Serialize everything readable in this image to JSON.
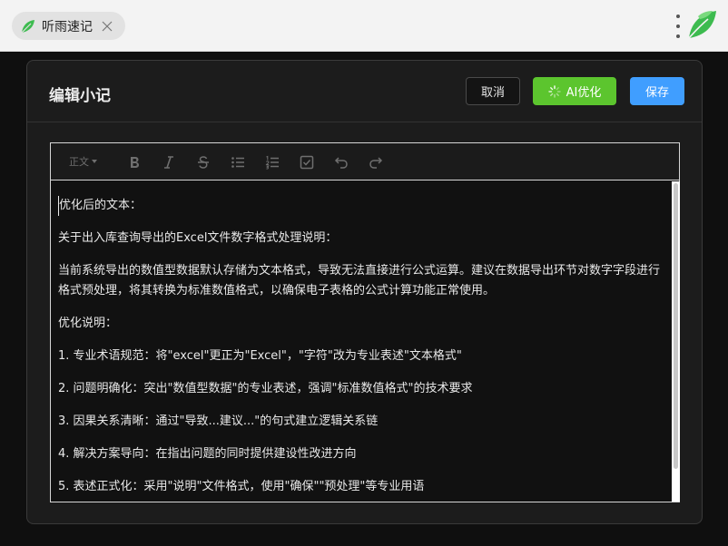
{
  "app": {
    "tab_title": "听雨速记"
  },
  "dialog": {
    "title": "编辑小记",
    "cancel_label": "取消",
    "ai_label": "AI优化",
    "save_label": "保存"
  },
  "toolbar": {
    "heading_select": "正文",
    "tools": [
      "bold-icon",
      "italic-icon",
      "strikethrough-icon",
      "bullet-list-icon",
      "ordered-list-icon",
      "checklist-icon",
      "undo-icon",
      "redo-icon"
    ]
  },
  "content": {
    "paragraphs": [
      "优化后的文本：",
      "关于出入库查询导出的Excel文件数字格式处理说明：",
      "当前系统导出的数值型数据默认存储为文本格式，导致无法直接进行公式运算。建议在数据导出环节对数字字段进行格式预处理，将其转换为标准数值格式，以确保电子表格的公式计算功能正常使用。",
      "优化说明：",
      "1. 专业术语规范：将\"excel\"更正为\"Excel\"，\"字符\"改为专业表述\"文本格式\"",
      "2. 问题明确化：突出\"数值型数据\"的专业表述，强调\"标准数值格式\"的技术要求",
      "3. 因果关系清晰：通过\"导致...建议...\"的句式建立逻辑关系链",
      "4. 解决方案导向：在指出问题的同时提供建设性改进方向",
      "5. 表述正式化：采用\"说明\"文件格式，使用\"确保\"\"预处理\"等专业用语"
    ]
  },
  "colors": {
    "ai_button": "#5cc52e",
    "save_button": "#409eff",
    "brand_green": "#3dbb4f"
  }
}
